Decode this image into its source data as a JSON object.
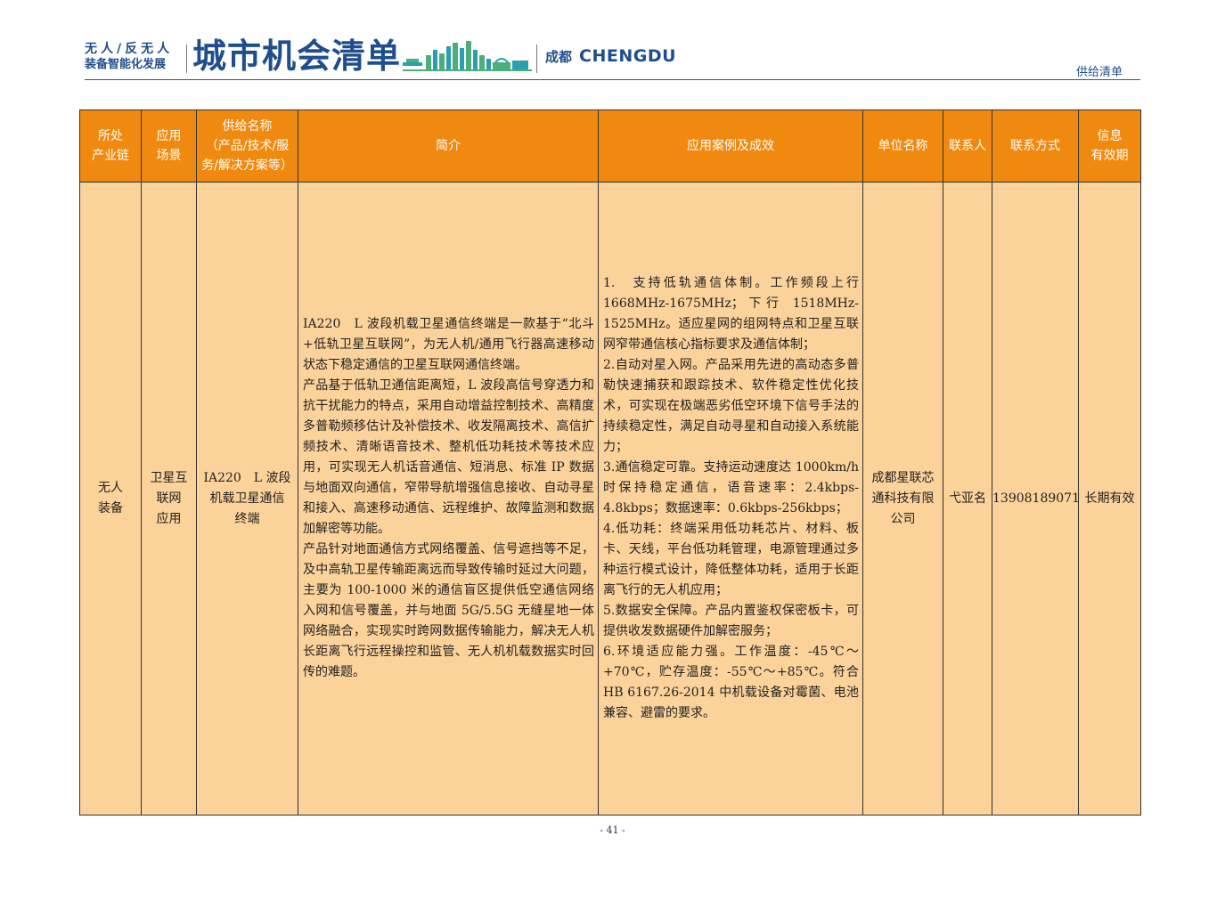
{
  "header": {
    "brand_line1": "无人/反无人",
    "brand_line2": "装备智能化发展",
    "title": "城市机会清单",
    "city_cn": "成都",
    "city_en": "CHENGDU",
    "section_label": "供给清单"
  },
  "table": {
    "columns": [
      {
        "lines": [
          "所处",
          "产业链"
        ]
      },
      {
        "lines": [
          "应用",
          "场景"
        ]
      },
      {
        "lines": [
          "供给名称",
          "（产品/技术/服",
          "务/解决方案等）"
        ]
      },
      {
        "lines": [
          "简介"
        ]
      },
      {
        "lines": [
          "应用案例及成效"
        ]
      },
      {
        "lines": [
          "单位名称"
        ]
      },
      {
        "lines": [
          "联系人"
        ]
      },
      {
        "lines": [
          "联系方式"
        ]
      },
      {
        "lines": [
          "信息",
          "有效期"
        ]
      }
    ],
    "row": {
      "industry_chain": [
        "无人",
        "装备"
      ],
      "scenario": [
        "卫星互",
        "联网",
        "应用"
      ],
      "supply_name": [
        "IA220　L 波段",
        "机载卫星通信",
        "终端"
      ],
      "intro": [
        "IA220　L 波段机载卫星通信终端是一款基于“北斗+低轨卫星互联网”，为无人机/通用飞行器高速移动状态下稳定通信的卫星互联网通信终端。",
        "产品基于低轨卫通信距离短，L 波段高信号穿透力和抗干扰能力的特点，采用自动增益控制技术、高精度多普勒频移估计及补偿技术、收发隔离技术、高信扩频技术、清晰语音技术、整机低功耗技术等技术应用，可实现无人机话音通信、短消息、标准 IP 数据与地面双向通信，窄带导航增强信息接收、自动寻星和接入、高速移动通信、远程维护、故障监测和数据加解密等功能。",
        "产品针对地面通信方式网络覆盖、信号遮挡等不足，及中高轨卫星传输距离远而导致传输时延过大问题，主要为 100-1000 米的通信盲区提供低空通信网络入网和信号覆盖，并与地面 5G/5.5G 无缝星地一体网络融合，实现实时跨网数据传输能力，解决无人机长距离飞行远程操控和监管、无人机机载数据实时回传的难题。"
      ],
      "cases": [
        "1.　支持低轨通信体制。工作频段上行 1668MHz-1675MHz；下行 1518MHz-1525MHz。适应星网的组网特点和卫星互联网窄带通信核心指标要求及通信体制；",
        "2.自动对星入网。产品采用先进的高动态多普勒快速捕获和跟踪技术、软件稳定性优化技术，可实现在极端恶劣低空环境下信号手法的持续稳定性，满足自动寻星和自动接入系统能力；",
        "3.通信稳定可靠。支持运动速度达 1000km/h 时保持稳定通信，语音速率：2.4kbps-4.8kbps；数据速率：0.6kbps-256kbps；",
        "4.低功耗：终端采用低功耗芯片、材料、板卡、天线，平台低功耗管理，电源管理通过多种运行模式设计，降低整体功耗，适用于长距离飞行的无人机应用；",
        "5.数据安全保障。产品内置鉴权保密板卡，可提供收发数据硬件加解密服务；",
        "6.环境适应能力强。工作温度：-45℃～+70℃，贮存温度：-55℃～+85℃。符合 HB 6167.26-2014 中机载设备对霉菌、电池兼容、避雷的要求。"
      ],
      "company": [
        "成都星联芯",
        "通科技有限",
        "公司"
      ],
      "contact": "弋亚名",
      "phone": "13908189071",
      "validity": "长期有效"
    }
  },
  "footer": {
    "page_number": "- 41 -"
  },
  "colors": {
    "header_fill": "#f0890f",
    "body_fill": "#fbd29a",
    "brand_blue": "#1f4e8c",
    "skyline_green": "#4caf7a",
    "skyline_teal": "#2a9fb0"
  }
}
